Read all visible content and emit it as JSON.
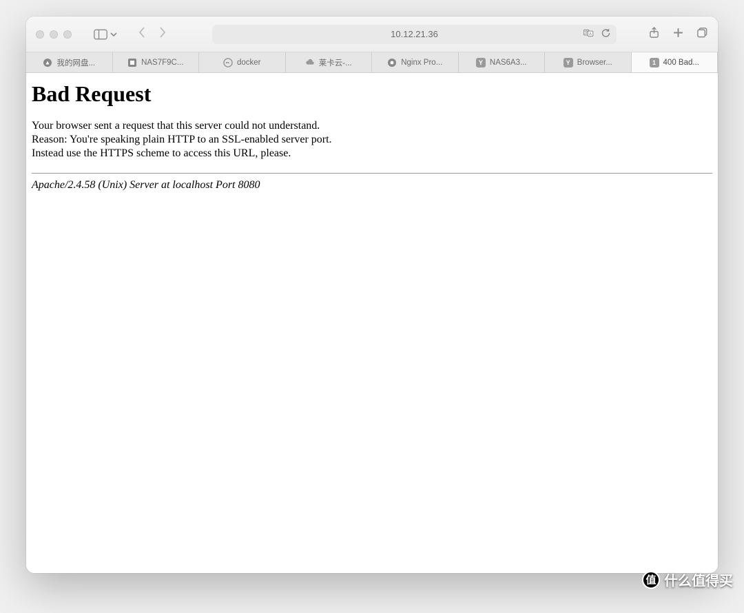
{
  "toolbar": {
    "address": "10.12.21.36"
  },
  "tabs": [
    {
      "label": "我的网盘...",
      "icon": "compass"
    },
    {
      "label": "NAS7F9C...",
      "icon": "square"
    },
    {
      "label": "docker",
      "icon": "docker"
    },
    {
      "label": "莱卡云-...",
      "icon": "cloud"
    },
    {
      "label": "Nginx Pro...",
      "icon": "circle"
    },
    {
      "label": "NAS6A3...",
      "icon": "letter-y"
    },
    {
      "label": "Browser...",
      "icon": "letter-y"
    },
    {
      "label": "400 Bad...",
      "icon": "letter-1",
      "active": true
    }
  ],
  "page": {
    "heading": "Bad Request",
    "line1": "Your browser sent a request that this server could not understand.",
    "line2": "Reason: You're speaking plain HTTP to an SSL-enabled server port.",
    "line3": "Instead use the HTTPS scheme to access this URL, please.",
    "server": "Apache/2.4.58 (Unix) Server at localhost Port 8080"
  },
  "watermark": {
    "badge": "值",
    "text": "什么值得买"
  }
}
